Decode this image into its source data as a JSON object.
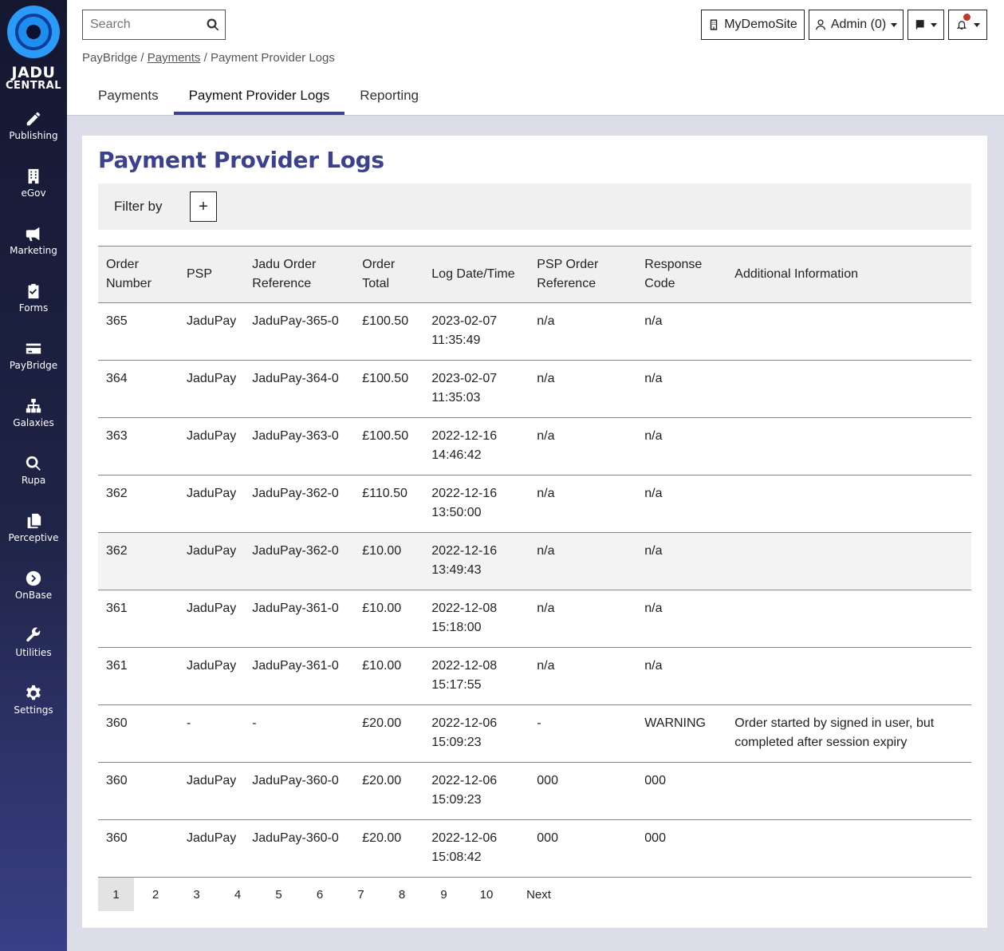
{
  "logo": {
    "line1": "JADU",
    "line2": "CENTRAL"
  },
  "sidebar": {
    "items": [
      {
        "label": "Publishing",
        "icon": "pencil-icon"
      },
      {
        "label": "eGov",
        "icon": "building-icon"
      },
      {
        "label": "Marketing",
        "icon": "megaphone-icon"
      },
      {
        "label": "Forms",
        "icon": "clipboard-icon"
      },
      {
        "label": "PayBridge",
        "icon": "credit-card-icon"
      },
      {
        "label": "Galaxies",
        "icon": "sitemap-icon"
      },
      {
        "label": "Rupa",
        "icon": "search-icon"
      },
      {
        "label": "Perceptive",
        "icon": "documents-icon"
      },
      {
        "label": "OnBase",
        "icon": "chevron-circle-icon"
      },
      {
        "label": "Utilities",
        "icon": "wrench-icon"
      },
      {
        "label": "Settings",
        "icon": "gear-icon"
      }
    ]
  },
  "header": {
    "search_placeholder": "Search",
    "site_button": "MyDemoSite",
    "admin_button": "Admin (0)"
  },
  "breadcrumb": {
    "root": "PayBridge",
    "sep": "/",
    "parent": "Payments",
    "current": "Payment Provider Logs"
  },
  "tabs": [
    {
      "label": "Payments",
      "active": false
    },
    {
      "label": "Payment Provider Logs",
      "active": true
    },
    {
      "label": "Reporting",
      "active": false
    }
  ],
  "page": {
    "title": "Payment Provider Logs",
    "filter_label": "Filter by",
    "filter_add": "+"
  },
  "table": {
    "headers": [
      "Order Number",
      "PSP",
      "Jadu Order Reference",
      "Order Total",
      "Log Date/Time",
      "PSP Order Reference",
      "Response Code",
      "Additional Information"
    ],
    "rows": [
      [
        "365",
        "JaduPay",
        "JaduPay-365-0",
        "£100.50",
        "2023-02-07 11:35:49",
        "n/a",
        "n/a",
        ""
      ],
      [
        "364",
        "JaduPay",
        "JaduPay-364-0",
        "£100.50",
        "2023-02-07 11:35:03",
        "n/a",
        "n/a",
        ""
      ],
      [
        "363",
        "JaduPay",
        "JaduPay-363-0",
        "£100.50",
        "2022-12-16 14:46:42",
        "n/a",
        "n/a",
        ""
      ],
      [
        "362",
        "JaduPay",
        "JaduPay-362-0",
        "£110.50",
        "2022-12-16 13:50:00",
        "n/a",
        "n/a",
        ""
      ],
      [
        "362",
        "JaduPay",
        "JaduPay-362-0",
        "£10.00",
        "2022-12-16 13:49:43",
        "n/a",
        "n/a",
        ""
      ],
      [
        "361",
        "JaduPay",
        "JaduPay-361-0",
        "£10.00",
        "2022-12-08 15:18:00",
        "n/a",
        "n/a",
        ""
      ],
      [
        "361",
        "JaduPay",
        "JaduPay-361-0",
        "£10.00",
        "2022-12-08 15:17:55",
        "n/a",
        "n/a",
        ""
      ],
      [
        "360",
        "-",
        "-",
        "£20.00",
        "2022-12-06 15:09:23",
        "-",
        "WARNING",
        "Order started by signed in user, but completed after session expiry"
      ],
      [
        "360",
        "JaduPay",
        "JaduPay-360-0",
        "£20.00",
        "2022-12-06 15:09:23",
        "000",
        "000",
        ""
      ],
      [
        "360",
        "JaduPay",
        "JaduPay-360-0",
        "£20.00",
        "2022-12-06 15:08:42",
        "000",
        "000",
        ""
      ]
    ]
  },
  "pagination": {
    "pages": [
      "1",
      "2",
      "3",
      "4",
      "5",
      "6",
      "7",
      "8",
      "9",
      "10"
    ],
    "current": "1",
    "next": "Next"
  },
  "colors": {
    "accent": "#3c418f",
    "notification_dot": "#c0392b",
    "sidebar_top": "#141730",
    "sidebar_bottom": "#3a3f86"
  }
}
